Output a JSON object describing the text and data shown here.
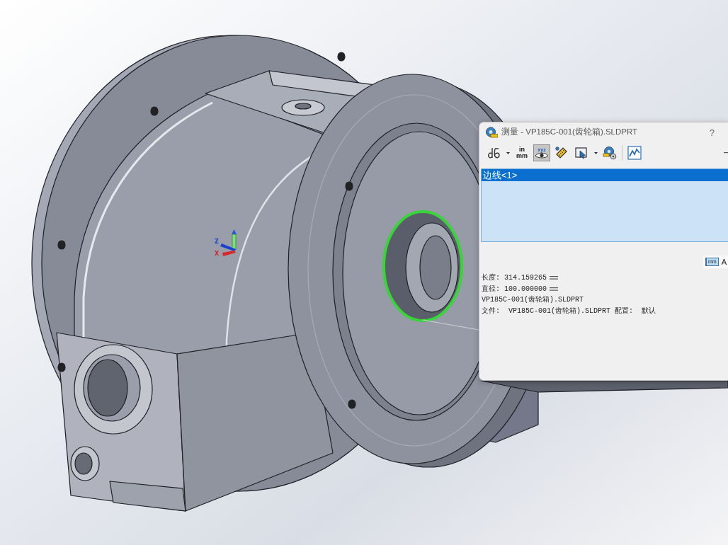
{
  "viewport": {
    "triad_labels": [
      {
        "text": "Z"
      },
      {
        "text": "X"
      }
    ]
  },
  "measure_dialog": {
    "title": "测量 - VP185C-001(齿轮箱).SLDPRT",
    "help_button": "?",
    "toolbar_groups": [
      {
        "buttons": [
          {
            "selected": false,
            "dropdown": true
          },
          {
            "selected": false,
            "dropdown": false,
            "lines": [
              "in",
              "mm"
            ]
          },
          {
            "selected": true,
            "dropdown": false,
            "lines": [
              "xyz"
            ]
          },
          {
            "selected": false,
            "dropdown": false
          },
          {
            "selected": false,
            "dropdown": true
          },
          {
            "selected": false,
            "dropdown": false
          }
        ]
      },
      {
        "buttons": [
          {
            "selected": false,
            "dropdown": false
          }
        ]
      }
    ],
    "selection_list": [
      {
        "label": "边线<1>",
        "selected": true
      }
    ],
    "units_button": {
      "icon_text": "mm",
      "label": "A"
    },
    "results": [
      {
        "text": "长度: 314.159265",
        "units_icon": true
      },
      {
        "text": "直径: 100.000000",
        "units_icon": true
      },
      {
        "text": "VP185C-001(齿轮箱).SLDPRT",
        "units_icon": false
      },
      {
        "text": "文件:  VP185C-001(齿轮箱).SLDPRT 配置:  默认",
        "units_icon": false
      }
    ]
  }
}
